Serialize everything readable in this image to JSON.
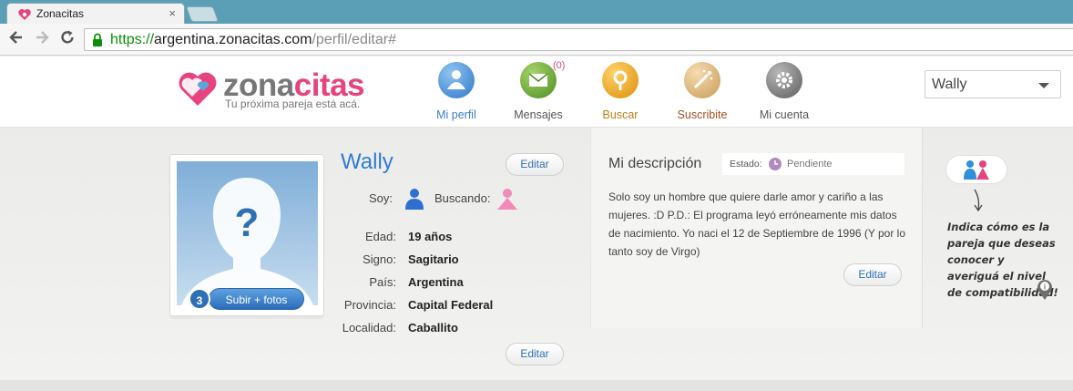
{
  "browser": {
    "tab_title": "Zonacitas",
    "tab_close": "×",
    "url_protocol": "https://",
    "url_host": "argentina.zonacitas.com",
    "url_path": "/perfil/editar#"
  },
  "header": {
    "brand_part1": "zona",
    "brand_part2": "citas",
    "tagline": "Tu próxima pareja está acá.",
    "nav": [
      {
        "label": "Mi perfil",
        "color": "#3d7ec8"
      },
      {
        "label": "Mensajes",
        "color": "#555555",
        "count": "(0)"
      },
      {
        "label": "Buscar",
        "color": "#c17d13"
      },
      {
        "label": "Suscribite",
        "color": "#a05020"
      },
      {
        "label": "Mi cuenta",
        "color": "#555555"
      }
    ],
    "user_select": "Wally"
  },
  "profile": {
    "name": "Wally",
    "edit_label": "Editar",
    "photo_count": "3",
    "upload_label": "Subir + fotos",
    "soy_label": "Soy:",
    "buscando_label": "Buscando:",
    "fields": [
      {
        "label": "Edad:",
        "value": "19 años"
      },
      {
        "label": "Signo:",
        "value": "Sagitario"
      },
      {
        "label": "País:",
        "value": "Argentina"
      },
      {
        "label": "Provincia:",
        "value": "Capital Federal"
      },
      {
        "label": "Localidad:",
        "value": "Caballito"
      }
    ],
    "bottom_edit_label": "Editar"
  },
  "description": {
    "title": "Mi descripción",
    "estado_label": "Estado:",
    "estado_value": "Pendiente",
    "text": "Solo soy un hombre que quiere darle amor y cariño a las mujeres. :D P.D.: El programa leyó erróneamente mis datos de nacimiento. Yo naci el 12 de Septiembre de 1996 (Y por lo tanto soy de Virgo)",
    "edit_label": "Editar"
  },
  "sidebar": {
    "hint": "Indica cómo es la pareja que deseas conocer y averiguá el nivel de compatibilidad!"
  },
  "colors": {
    "brand_pink": "#e6437f",
    "link_blue": "#2f7cd1",
    "tabbar": "#5a9fb6"
  }
}
